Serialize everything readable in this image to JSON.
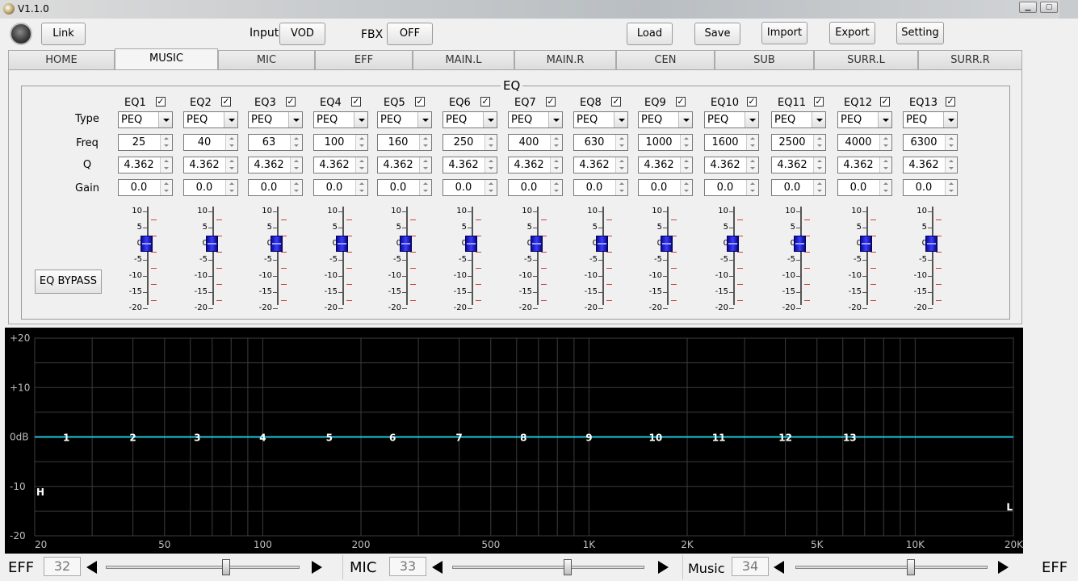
{
  "window": {
    "title": "V1.1.0",
    "min_glyph": "▁",
    "max_glyph": "▢"
  },
  "toolbar": {
    "link_label": "Link",
    "input_label": "Input",
    "input_value": "VOD",
    "fbx_label": "FBX",
    "fbx_value": "OFF",
    "load_label": "Load",
    "save_label": "Save",
    "import_label": "Import",
    "export_label": "Export",
    "setting_label": "Setting"
  },
  "tabs": [
    "HOME",
    "MUSIC",
    "MIC",
    "EFF",
    "MAIN.L",
    "MAIN.R",
    "CEN",
    "SUB",
    "SURR.L",
    "SURR.R"
  ],
  "active_tab": "MUSIC",
  "eq": {
    "title": "EQ",
    "row_labels": {
      "type": "Type",
      "freq": "Freq",
      "q": "Q",
      "gain": "Gain"
    },
    "bypass_label": "EQ BYPASS",
    "check_glyph": "✓",
    "scale_labels": [
      "10",
      "5",
      "0",
      "-5",
      "-10",
      "-15",
      "-20"
    ],
    "bands": [
      {
        "name": "EQ1",
        "enabled": true,
        "type": "PEQ",
        "freq": "25",
        "q": "4.362",
        "gain": "0.0",
        "level": 0
      },
      {
        "name": "EQ2",
        "enabled": true,
        "type": "PEQ",
        "freq": "40",
        "q": "4.362",
        "gain": "0.0",
        "level": 0
      },
      {
        "name": "EQ3",
        "enabled": true,
        "type": "PEQ",
        "freq": "63",
        "q": "4.362",
        "gain": "0.0",
        "level": 0
      },
      {
        "name": "EQ4",
        "enabled": true,
        "type": "PEQ",
        "freq": "100",
        "q": "4.362",
        "gain": "0.0",
        "level": 0
      },
      {
        "name": "EQ5",
        "enabled": true,
        "type": "PEQ",
        "freq": "160",
        "q": "4.362",
        "gain": "0.0",
        "level": 0
      },
      {
        "name": "EQ6",
        "enabled": true,
        "type": "PEQ",
        "freq": "250",
        "q": "4.362",
        "gain": "0.0",
        "level": 0
      },
      {
        "name": "EQ7",
        "enabled": true,
        "type": "PEQ",
        "freq": "400",
        "q": "4.362",
        "gain": "0.0",
        "level": 0
      },
      {
        "name": "EQ8",
        "enabled": true,
        "type": "PEQ",
        "freq": "630",
        "q": "4.362",
        "gain": "0.0",
        "level": 0
      },
      {
        "name": "EQ9",
        "enabled": true,
        "type": "PEQ",
        "freq": "1000",
        "q": "4.362",
        "gain": "0.0",
        "level": 0
      },
      {
        "name": "EQ10",
        "enabled": true,
        "type": "PEQ",
        "freq": "1600",
        "q": "4.362",
        "gain": "0.0",
        "level": 0
      },
      {
        "name": "EQ11",
        "enabled": true,
        "type": "PEQ",
        "freq": "2500",
        "q": "4.362",
        "gain": "0.0",
        "level": 0
      },
      {
        "name": "EQ12",
        "enabled": true,
        "type": "PEQ",
        "freq": "4000",
        "q": "4.362",
        "gain": "0.0",
        "level": 0
      },
      {
        "name": "EQ13",
        "enabled": true,
        "type": "PEQ",
        "freq": "6300",
        "q": "4.362",
        "gain": "0.0",
        "level": 0
      }
    ]
  },
  "chart_data": {
    "type": "line",
    "title": "",
    "xlabel": "",
    "ylabel": "",
    "x_scale": "log",
    "xlim": [
      20,
      20000
    ],
    "ylim": [
      -20,
      20
    ],
    "x_tick_labels": [
      {
        "v": 20,
        "t": "20"
      },
      {
        "v": 50,
        "t": "50"
      },
      {
        "v": 100,
        "t": "100"
      },
      {
        "v": 200,
        "t": "200"
      },
      {
        "v": 500,
        "t": "500"
      },
      {
        "v": 1000,
        "t": "1K"
      },
      {
        "v": 2000,
        "t": "2K"
      },
      {
        "v": 5000,
        "t": "5K"
      },
      {
        "v": 10000,
        "t": "10K"
      },
      {
        "v": 20000,
        "t": "20K"
      }
    ],
    "y_tick_labels": [
      {
        "v": 20,
        "t": "+20"
      },
      {
        "v": 10,
        "t": "+10"
      },
      {
        "v": 0,
        "t": "0dB"
      },
      {
        "v": -10,
        "t": "-10"
      },
      {
        "v": -20,
        "t": "-20"
      }
    ],
    "grid": true,
    "background": "#000000",
    "curve_color": "#1ec8d8",
    "series": [
      {
        "x": [
          20,
          20000
        ],
        "y": [
          0,
          0
        ]
      }
    ],
    "markers": [
      {
        "label": "1",
        "x": 25,
        "y": 0
      },
      {
        "label": "2",
        "x": 40,
        "y": 0
      },
      {
        "label": "3",
        "x": 63,
        "y": 0
      },
      {
        "label": "4",
        "x": 100,
        "y": 0
      },
      {
        "label": "5",
        "x": 160,
        "y": 0
      },
      {
        "label": "6",
        "x": 250,
        "y": 0
      },
      {
        "label": "7",
        "x": 400,
        "y": 0
      },
      {
        "label": "8",
        "x": 630,
        "y": 0
      },
      {
        "label": "9",
        "x": 1000,
        "y": 0
      },
      {
        "label": "10",
        "x": 1600,
        "y": 0
      },
      {
        "label": "11",
        "x": 2500,
        "y": 0
      },
      {
        "label": "12",
        "x": 4000,
        "y": 0
      },
      {
        "label": "13",
        "x": 6300,
        "y": 0
      }
    ],
    "corner_labels": [
      {
        "label": "H",
        "x": 20,
        "y": -11
      },
      {
        "label": "L",
        "x": 20000,
        "y": -14
      }
    ]
  },
  "bottom": {
    "eff_label": "EFF",
    "eff_value": "32",
    "eff_level": 0.62,
    "mic_label": "MIC",
    "mic_value": "33",
    "mic_level": 0.6,
    "music_label": "Music",
    "music_value": "34",
    "music_level": 0.6,
    "right_label": "EFF"
  },
  "colors": {
    "accent_thumb": "#2a2ae0",
    "tick_red": "#d24040"
  }
}
